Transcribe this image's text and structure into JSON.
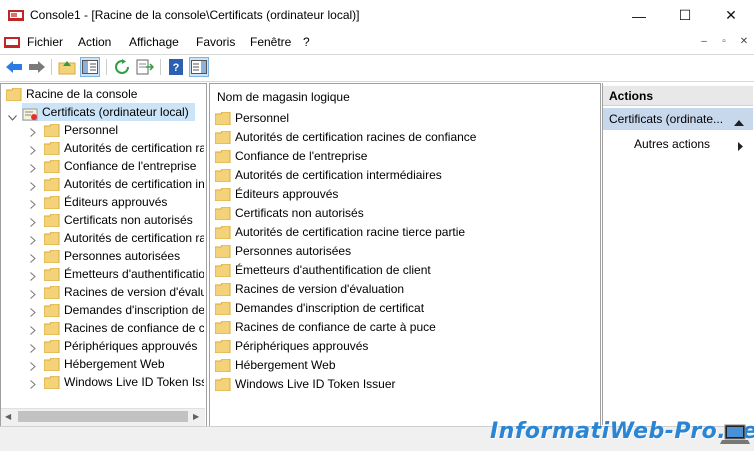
{
  "window": {
    "title": "Console1 - [Racine de la console\\Certificats (ordinateur local)]",
    "minimize": "—",
    "maximize": "☐",
    "close": "✕"
  },
  "menu": {
    "items": [
      "Fichier",
      "Action",
      "Affichage",
      "Favoris",
      "Fenêtre",
      "?"
    ],
    "mdi": [
      "–",
      "▫",
      "✕"
    ]
  },
  "tree": {
    "root": "Racine de la console",
    "store": "Certificats (ordinateur local)",
    "children": [
      "Personnel",
      "Autorités de certification ra",
      "Confiance de l'entreprise",
      "Autorités de certification in",
      "Éditeurs approuvés",
      "Certificats non autorisés",
      "Autorités de certification ra",
      "Personnes autorisées",
      "Émetteurs d'authentificatio",
      "Racines de version d'évalua",
      "Demandes d'inscription de",
      "Racines de confiance de ca",
      "Périphériques approuvés",
      "Hébergement Web",
      "Windows Live ID Token Issu"
    ]
  },
  "list": {
    "column": "Nom de magasin logique",
    "items": [
      "Personnel",
      "Autorités de certification racines de confiance",
      "Confiance de l'entreprise",
      "Autorités de certification intermédiaires",
      "Éditeurs approuvés",
      "Certificats non autorisés",
      "Autorités de certification racine tierce partie",
      "Personnes autorisées",
      "Émetteurs d'authentification de client",
      "Racines de version d'évaluation",
      "Demandes d'inscription de certificat",
      "Racines de confiance de carte à puce",
      "Périphériques approuvés",
      "Hébergement Web",
      "Windows Live ID Token Issuer"
    ]
  },
  "actions": {
    "header": "Actions",
    "selected": "Certificats (ordinate...",
    "more": "Autres actions"
  },
  "watermark": "InformatiWeb-Pro.net",
  "colors": {
    "folder": "#f3d27a",
    "folder_dark": "#d9a93a",
    "selected": "#c8d8ec",
    "watermark": "#2a86d4"
  }
}
